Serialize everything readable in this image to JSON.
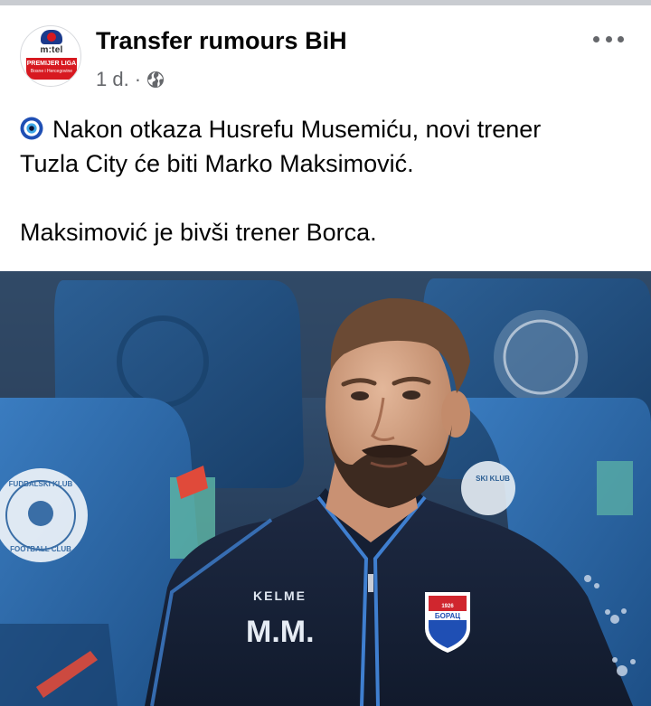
{
  "post": {
    "page_name": "Transfer rumours BiH",
    "time_ago": "1 d.",
    "separator": "·",
    "audience_icon": "globe-icon",
    "more_icon": "more-options-icon",
    "emoji_icon": "nazar-amulet-icon",
    "text_lines": [
      "Nakon otkaza Husrefu Musemiću, novi trener",
      "Tuzla City će biti Marko Maksimović.",
      "",
      "Maksimović je bivši trener Borca."
    ]
  },
  "avatar": {
    "brand": "m:tel",
    "league_line1": "PREMIJER LIGA",
    "league_line2": "Bosne i Hercegovine"
  },
  "photo": {
    "jacket_brand": "KELME",
    "jacket_initials": "M.M.",
    "crest_text": "БОРАЦ",
    "crest_year": "1926",
    "seat_crest_text_left": "FUDBALSKI KLUB",
    "seat_crest_text_left_bottom": "FOOTBALL CLUB",
    "seat_crest_text_right": "SKI KLUB",
    "colors": {
      "seat_blue": "#2f6aa6",
      "jacket_navy": "#1a2338",
      "jacket_accent": "#3f7fd0",
      "crest_red": "#d0262e"
    }
  },
  "colors": {
    "text": "#050505",
    "meta": "#65676b",
    "divider": "#c9ccd1"
  }
}
